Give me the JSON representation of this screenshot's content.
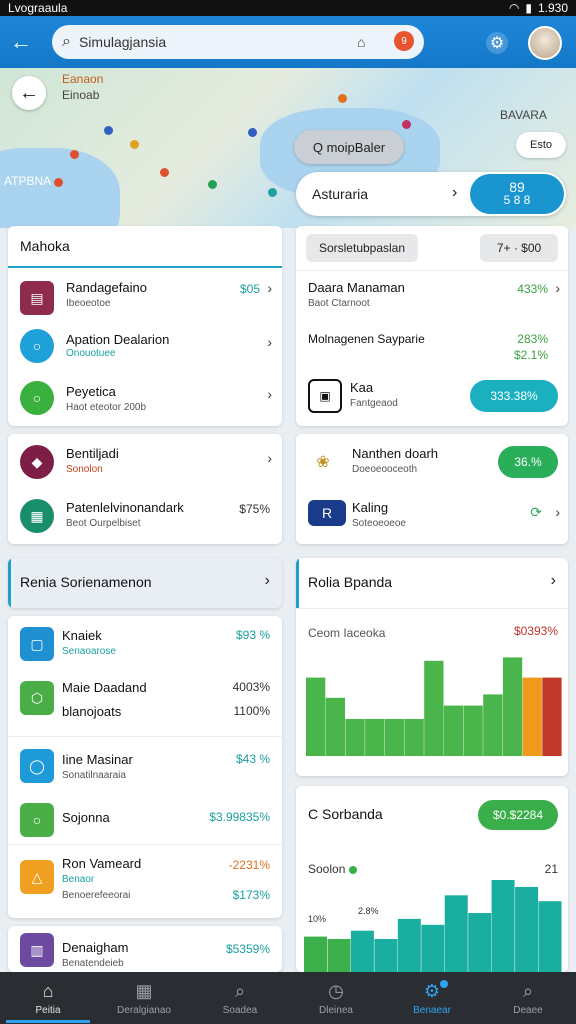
{
  "status": {
    "left": "Lvograaula",
    "time": "1.930"
  },
  "appbar": {
    "search_value": "Simulagjansia",
    "badge": "9"
  },
  "map": {
    "labels": [
      "Eanaon",
      "Einoab",
      "BAVARA",
      "ATPBNA",
      "Esoto"
    ],
    "chip": "Q moipBaler",
    "zoom": "Esto"
  },
  "route": {
    "place": "Asturaria",
    "eta_top": "89",
    "eta_bottom": "5 8 8"
  },
  "left_card1": {
    "title": "Mahoka",
    "rows": [
      {
        "title": "Randagefaino",
        "sub": "Ibeoeotoe",
        "value": "$05",
        "color": "#8e2b4e"
      },
      {
        "title": "Apation Dealarion",
        "sub": "Onouotuee",
        "value": "",
        "color": "#1ea0d8"
      },
      {
        "title": "Peyetica",
        "sub": "Haot eteotor 200b",
        "value": "",
        "color": "#3ab03e"
      }
    ]
  },
  "left_card2": {
    "rows": [
      {
        "title": "Bentiljadi",
        "sub": "Sonolon",
        "value": "",
        "color": "#7c1e45"
      },
      {
        "title": "Patenlelvinonandark",
        "sub": "Beot Ourpelbiset",
        "value": "$75%",
        "color": "#1a8d6a"
      }
    ]
  },
  "right_card1": {
    "tab": "Sorsletubpaslan",
    "range": "7+ · $00",
    "rows": [
      {
        "title": "Daara Manaman",
        "sub": "Baot Ctarnoot",
        "value": "433%",
        "value2": ""
      },
      {
        "title": "Molnagenen Sayparie",
        "sub": "",
        "value": "283%",
        "value2": "$2.1%"
      },
      {
        "title": "Kaa",
        "sub": "Fantgeaod",
        "value": "",
        "value2": ""
      }
    ],
    "pill": "333.38%"
  },
  "right_card2": {
    "rows": [
      {
        "title": "Nanthen doarh",
        "sub": "Doeoeooceoth",
        "pill": "36.%"
      },
      {
        "title": "Kaling",
        "sub": "Soteoeoeoe",
        "pill": ""
      }
    ]
  },
  "left_list": {
    "header": "Renia Sorienamenon",
    "rows": [
      {
        "title": "Knaiek",
        "sub": "Senaoarose",
        "value": "$93 %",
        "color": "#1e8fd0",
        "vclass": "teal"
      },
      {
        "title": "Maie Daadand",
        "sub": "",
        "value": "4003%",
        "color": "#4aae46",
        "vclass": "dark"
      },
      {
        "title": "blanojoats",
        "sub": "",
        "value": "1100%",
        "color": "",
        "vclass": "dark"
      },
      {
        "title": "Iine Masinar",
        "sub": "Sonatilnaaraia",
        "value": "$43 %",
        "color": "#1e9ad8",
        "vclass": "teal"
      },
      {
        "title": "Sojonna",
        "sub": "",
        "value": "$3.99835%",
        "color": "#4aae46",
        "vclass": "teal"
      },
      {
        "title": "Ron Vameard",
        "sub": "Benaor",
        "value": "-2231%",
        "color": "#f0a020",
        "vclass": "orange"
      },
      {
        "title": "",
        "sub": "Benoerefeeorai",
        "value": "$173%",
        "color": "",
        "vclass": "teal"
      },
      {
        "title": "Denaigham",
        "sub": "Benatendeieb",
        "value": "$5359%",
        "color": "#6b4aa0",
        "vclass": "teal"
      }
    ]
  },
  "chart1_card": {
    "header": "Rolia Bpanda",
    "label": "Ceom Iaceoka",
    "value": "$0393%"
  },
  "chart2_card": {
    "title": "C Sorbanda",
    "pill": "$0.$2284",
    "series_label": "Soolon",
    "max_label": "21",
    "tick_a": "10%",
    "tick_b": "2.8%"
  },
  "chart_data": [
    {
      "type": "bar",
      "values": [
        70,
        52,
        33,
        33,
        33,
        33,
        85,
        45,
        45,
        55,
        88,
        70,
        70
      ],
      "colors": [
        "#4ab54a",
        "#4ab54a",
        "#4ab54a",
        "#4ab54a",
        "#4ab54a",
        "#4ab54a",
        "#4ab54a",
        "#4ab54a",
        "#4ab54a",
        "#4ab54a",
        "#4ab54a",
        "#f09a1c",
        "#c0392b"
      ],
      "ylim": [
        0,
        100
      ]
    },
    {
      "type": "bar",
      "values": [
        30,
        28,
        35,
        28,
        45,
        40,
        65,
        50,
        78,
        72,
        60
      ],
      "colors": [
        "#3cb04a",
        "#3cb04a",
        "#1aaea0",
        "#1aaea0",
        "#1aaea0",
        "#1aaea0",
        "#1aaea0",
        "#1aaea0",
        "#1aaea0",
        "#1aaea0",
        "#1aaea0"
      ],
      "ylim": [
        0,
        100
      ]
    }
  ],
  "nav": [
    {
      "label": "Peitia",
      "icon": "⌂"
    },
    {
      "label": "Deralgianao",
      "icon": "▦"
    },
    {
      "label": "Soadea",
      "icon": "⌕"
    },
    {
      "label": "Dleinea",
      "icon": "◷"
    },
    {
      "label": "Benaear",
      "icon": "⚙"
    },
    {
      "label": "Deaee",
      "icon": "⌕"
    }
  ]
}
